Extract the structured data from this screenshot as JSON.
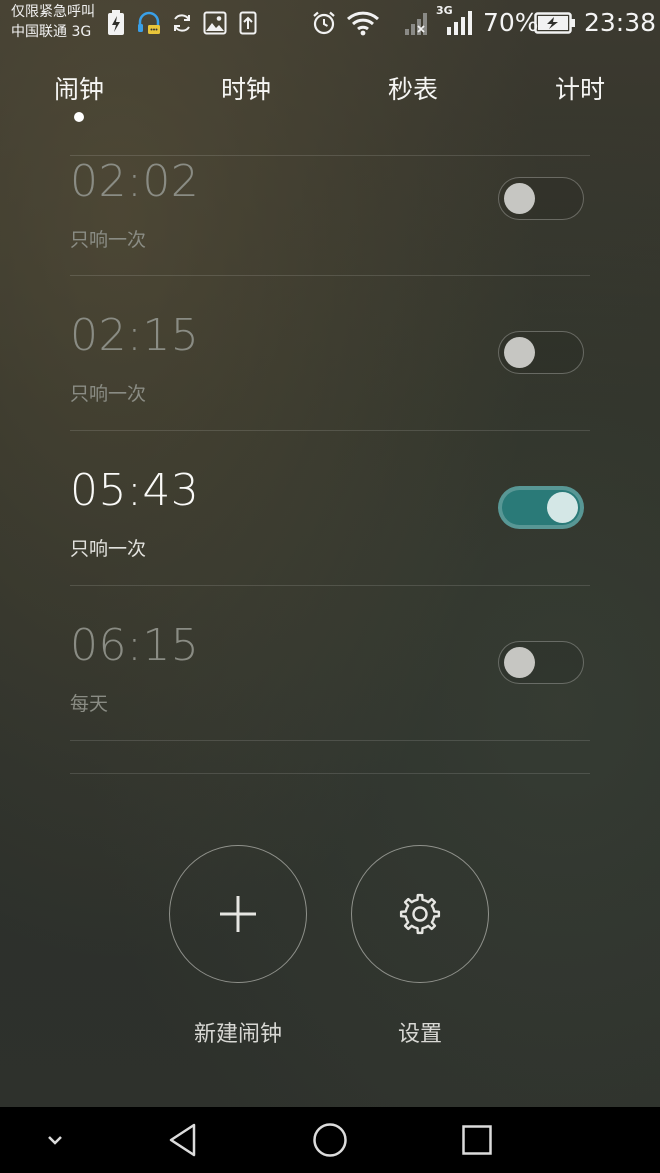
{
  "status_bar": {
    "carrier_line1": "仅限紧急呼叫",
    "carrier_line2": "中国联通 3G",
    "network_label": "3G",
    "battery_percent": "70%",
    "time": "23:38",
    "icons": [
      "battery-charging-icon",
      "headset-notification-icon",
      "sync-icon",
      "image-icon",
      "upload-icon",
      "alarm-clock-icon",
      "wifi-icon",
      "signal-icon",
      "battery-icon"
    ]
  },
  "tabs": [
    {
      "label": "闹钟",
      "active": true
    },
    {
      "label": "时钟",
      "active": false
    },
    {
      "label": "秒表",
      "active": false
    },
    {
      "label": "计时",
      "active": false
    }
  ],
  "alarms": [
    {
      "time": "02:02",
      "repeat": "只响一次",
      "enabled": false
    },
    {
      "time": "02:15",
      "repeat": "只响一次",
      "enabled": false
    },
    {
      "time": "05:43",
      "repeat": "只响一次",
      "enabled": true
    },
    {
      "time": "06:15",
      "repeat": "每天",
      "enabled": false
    }
  ],
  "actions": {
    "new_alarm_label": "新建闹钟",
    "settings_label": "设置"
  },
  "colors": {
    "toggle_on": "#2a7a78",
    "nav_bar": "#000000"
  },
  "nav_bar": {
    "icons": [
      "chevron-down-icon",
      "back-icon",
      "home-icon",
      "recents-icon"
    ]
  }
}
